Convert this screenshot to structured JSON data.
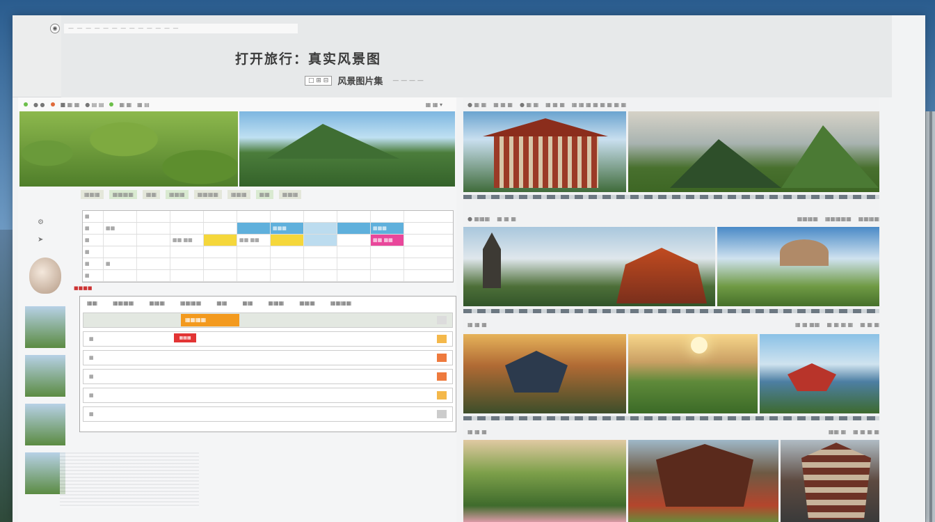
{
  "header": {
    "title": "打开旅行：真实风景图",
    "address_text": "— — — — — — — — — — — — —",
    "sub_box": "□ ⊞ ⊟",
    "sub_text": "风景图片集",
    "sub_extra": "— — — —"
  },
  "left_panel": {
    "toolbar": [
      "● ●",
      "■ ▦ ▦",
      "● ▤ ▤",
      "▦ ▦",
      "▦ ▤"
    ],
    "toolbar_right": "▦ ▦ ▾",
    "tabs": [
      "▦▦▦",
      "▦▦▦▦",
      "▦▦",
      "▦▦▦",
      "▦▦▦▦",
      "▦▦▦",
      "▦▦",
      "▦▦▦"
    ],
    "section_label": "■■■■",
    "grid1": {
      "rows": [
        [
          "▦",
          "",
          "",
          "",
          "",
          "",
          "",
          "",
          "",
          ""
        ],
        [
          "▦",
          "▦▦",
          "",
          "",
          "",
          "",
          "▦▦▦",
          "",
          "",
          "▦▦▦"
        ],
        [
          "▦",
          "",
          "",
          "▦▦ ▦▦",
          "",
          "▦▦ ▦▦",
          "",
          "",
          "",
          "▦▦ ▦▦"
        ],
        [
          "▦",
          "",
          "",
          "",
          "",
          "",
          "",
          "",
          "",
          ""
        ],
        [
          "▦",
          "▦",
          "",
          "",
          "",
          "",
          "",
          "",
          "",
          ""
        ],
        [
          "▦",
          "",
          "",
          "",
          "",
          "",
          "",
          "",
          "",
          ""
        ]
      ]
    },
    "grid2": {
      "head": [
        "▦▦",
        "▦▦▦▦",
        "▦▦▦",
        "▦▦▦▦",
        "▦▦",
        "▦▦",
        "▦▦▦",
        "▦▦▦",
        "▦▦▦▦"
      ],
      "orange_label": "▦▦▦▦",
      "red_label": "▦▦▦",
      "rows": [
        "▦",
        "▦",
        "▦",
        "▦",
        "▦",
        "▦"
      ]
    }
  },
  "right_panel": {
    "bar1": [
      "● ▦ ▦",
      "▦ ▦ ▦",
      "● ▦ ▦",
      "▦ ▦ ▦",
      "▦ ▦ ▦ ▦ ▦ ▦ ▦ ▦"
    ],
    "bar2": [
      "● ▦▦▦",
      "▦ ▦ ▦",
      "▦▦▦▦",
      "▦▦▦▦▦",
      "▦▦▦▦"
    ],
    "bar3": [
      "▦ ▦ ▦",
      "▦ ▦ ▦▦",
      "▦ ▦ ▦ ▦",
      "▦ ▦ ▦"
    ],
    "bar4": [
      "▦ ▦ ▦",
      "▦▦ ▦",
      "▦ ▦ ▦ ▦"
    ]
  },
  "colors": {
    "accent_orange": "#f39a1e",
    "accent_red": "#e23434",
    "accent_blue": "#5fb0dc",
    "accent_yellow": "#f5d73b",
    "accent_pink": "#e9479b"
  }
}
